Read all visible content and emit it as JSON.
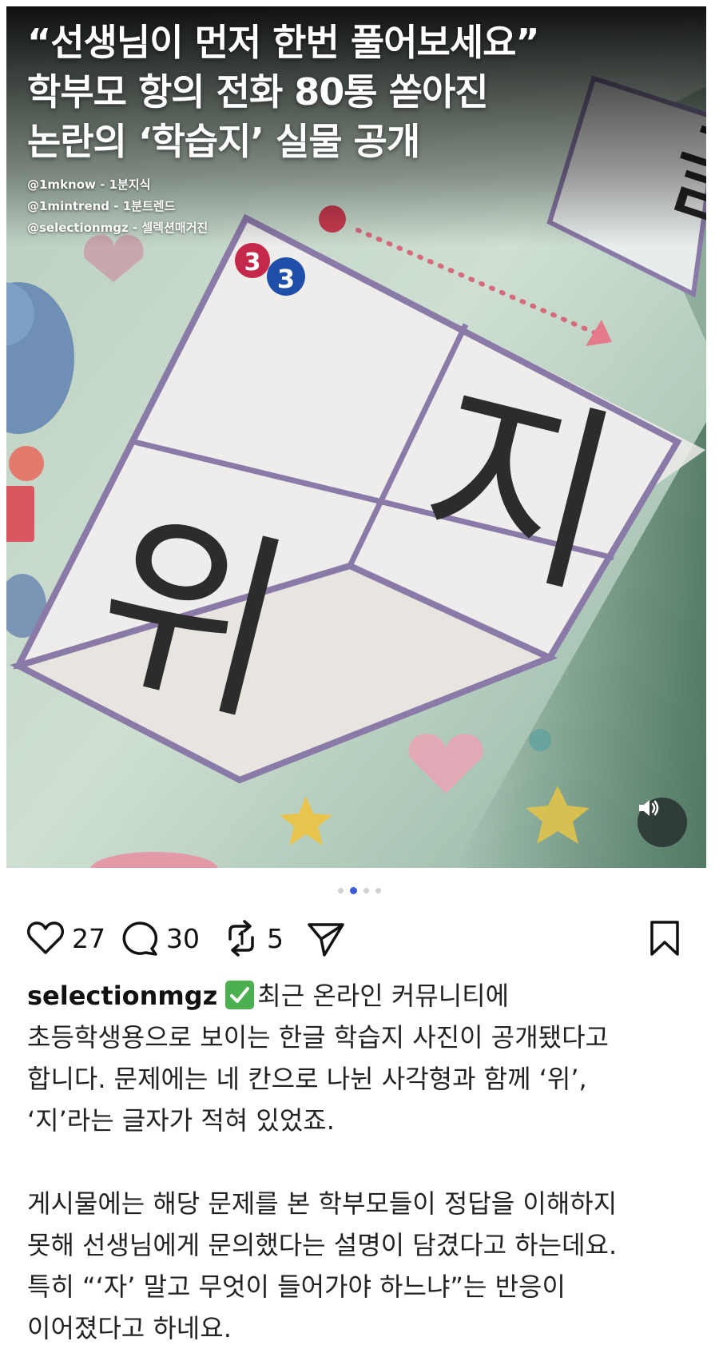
{
  "post": {
    "headline": [
      "“선생님이 먼저 한번 풀어보세요”",
      "학부모 항의 전화 80통 쏟아진",
      "논란의 ‘학습지’ 실물 공개"
    ],
    "credits": [
      "@1mknow - 1분지식",
      "@1mintrend - 1분트렌드",
      "@selectionmgz - 셀렉션매거진"
    ],
    "sheet": {
      "char_left": "위",
      "char_right": "지",
      "badge_a": "3",
      "badge_b": "3",
      "corner_char": "글"
    },
    "carousel": {
      "count": 4,
      "active": 1
    },
    "stats": {
      "likes": "27",
      "comments": "30",
      "reposts": "5"
    },
    "caption": {
      "username": "selectionmgz",
      "line1": "최근 온라인 커뮤니티에",
      "line2": "초등학생용으로 보이는 한글 학습지 사진이 공개됐다고",
      "line3": "합니다. 문제에는 네 칸으로 나뉜 사각형과 함께 ‘위’,",
      "line4": "‘지’라는 글자가 적혀 있었죠.",
      "line5": "게시물에는 해당 문제를 본 학부모들이 정답을 이해하지",
      "line6": "못해 선생님에게 문의했다는 설명이 담겼다고 하는데요.",
      "line7": "특히 “‘자’ 말고 무엇이 들어가야 하느냐”는 반응이",
      "line8": "이어졌다고 하네요."
    }
  },
  "icons": {
    "like": "heart-icon",
    "comment": "comment-bubble-icon",
    "repost": "repost-icon",
    "share": "send-icon",
    "save": "bookmark-icon",
    "sound": "speaker-icon",
    "verified": "check-badge-icon"
  },
  "colors": {
    "active_dot": "#3b5bdb",
    "verified": "#4caf50",
    "sheet_border": "#8a7aa8",
    "badge_red": "#c4284a",
    "badge_blue": "#1f4fa8"
  }
}
